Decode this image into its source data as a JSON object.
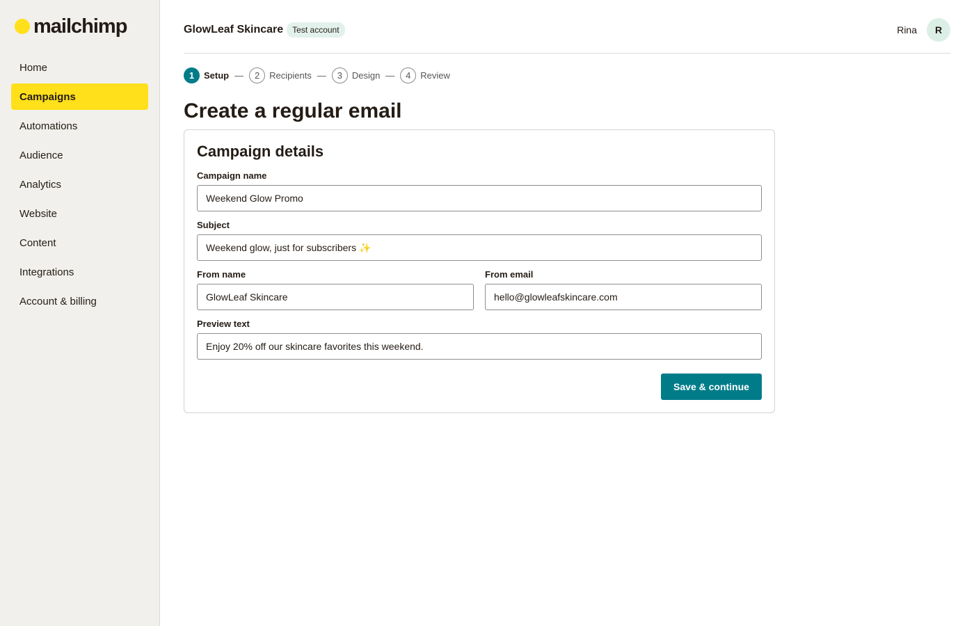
{
  "brand": {
    "logo_text": "mailchimp",
    "accent": "#ffe01b",
    "primary": "#007c89"
  },
  "sidebar": {
    "items": [
      {
        "label": "Home"
      },
      {
        "label": "Campaigns",
        "active": true
      },
      {
        "label": "Automations"
      },
      {
        "label": "Audience"
      },
      {
        "label": "Analytics"
      },
      {
        "label": "Website"
      },
      {
        "label": "Content"
      },
      {
        "label": "Integrations"
      },
      {
        "label": "Account & billing"
      }
    ]
  },
  "header": {
    "org_name": "GlowLeaf Skincare",
    "badge": "Test account",
    "user_name": "Rina",
    "avatar_initial": "R"
  },
  "steps": [
    {
      "num": "1",
      "label": "Setup",
      "active": true
    },
    {
      "num": "2",
      "label": "Recipients"
    },
    {
      "num": "3",
      "label": "Design"
    },
    {
      "num": "4",
      "label": "Review"
    }
  ],
  "step_separator": "—",
  "page_title": "Create a regular email",
  "form": {
    "title": "Campaign details",
    "campaign_name": {
      "label": "Campaign name",
      "value": "Weekend Glow Promo"
    },
    "subject": {
      "label": "Subject",
      "value": "Weekend glow, just for subscribers ✨"
    },
    "from_name": {
      "label": "From name",
      "value": "GlowLeaf Skincare"
    },
    "from_email": {
      "label": "From email",
      "value": "hello@glowleafskincare.com"
    },
    "preview_text": {
      "label": "Preview text",
      "value": "Enjoy 20% off our skincare favorites this weekend."
    },
    "submit_label": "Save & continue"
  }
}
